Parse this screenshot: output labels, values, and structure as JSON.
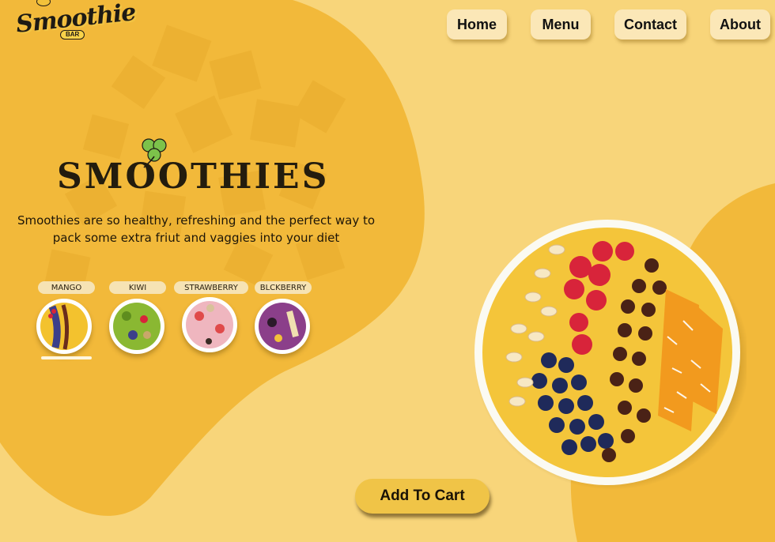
{
  "brand": {
    "logo_text": "Smoothie",
    "logo_sub": "BAR"
  },
  "nav": {
    "items": [
      {
        "label": "Home"
      },
      {
        "label": "Menu"
      },
      {
        "label": "Contact"
      },
      {
        "label": "About"
      }
    ]
  },
  "hero": {
    "title": "SMOOTHIES",
    "description": "Smoothies are so healthy, refreshing and the perfect way to pack some extra friut and vaggies into your diet"
  },
  "flavors": {
    "items": [
      {
        "label": "MANGO",
        "selected": true,
        "icon": "mango-bowl-icon"
      },
      {
        "label": "KIWI",
        "selected": false,
        "icon": "kiwi-bowl-icon"
      },
      {
        "label": "STRAWBERRY",
        "selected": false,
        "icon": "strawberry-bowl-icon"
      },
      {
        "label": "BLCKBERRY",
        "selected": false,
        "icon": "blackberry-bowl-icon"
      }
    ]
  },
  "cart": {
    "label": "Add To Cart"
  },
  "colors": {
    "background": "#f8d57a",
    "blob": "#f2b93a",
    "nav_button": "#fbe7b7",
    "cart_button": "#f0c447",
    "text_dark": "#231c0e"
  }
}
